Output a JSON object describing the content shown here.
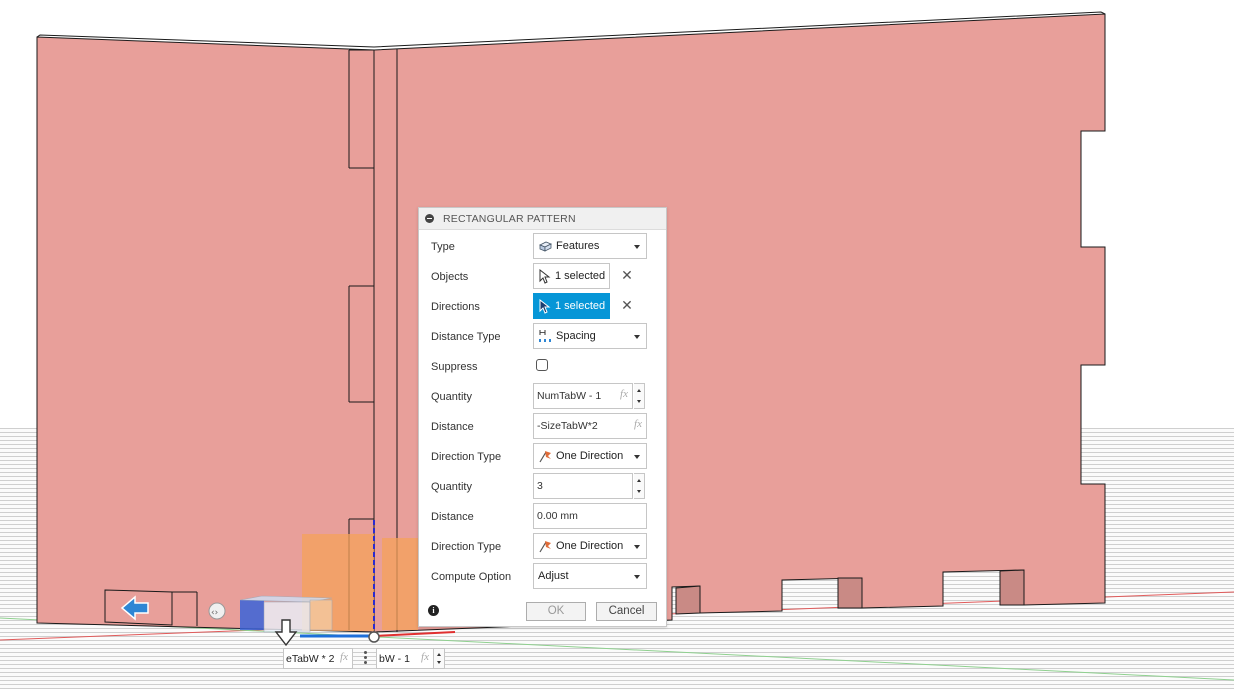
{
  "dialog": {
    "title": "RECTANGULAR PATTERN",
    "type_label": "Type",
    "type_value": "Features",
    "objects_label": "Objects",
    "objects_value": "1 selected",
    "directions_label": "Directions",
    "directions_value": "1 selected",
    "distance_type_label": "Distance Type",
    "distance_type_value": "Spacing",
    "suppress_label": "Suppress",
    "quantity1_label": "Quantity",
    "quantity1_value": "NumTabW - 1",
    "distance1_label": "Distance",
    "distance1_value": "-SizeTabW*2",
    "direction_type1_label": "Direction Type",
    "direction_type1_value": "One Direction",
    "quantity2_label": "Quantity",
    "quantity2_value": "3",
    "distance2_label": "Distance",
    "distance2_value": "0.00 mm",
    "direction_type2_label": "Direction Type",
    "direction_type2_value": "One Direction",
    "compute_option_label": "Compute Option",
    "compute_option_value": "Adjust",
    "ok_label": "OK",
    "cancel_label": "Cancel",
    "fx_label": "fx",
    "clear_symbol": "✕",
    "info_symbol": "i"
  },
  "viewport": {
    "field1_value": "eTabW * 2",
    "field2_value": "bW - 1",
    "fx_label": "fx"
  },
  "colors": {
    "panel_fill": "#e89f9a",
    "active_selection": "#0696d7",
    "preview_orange": "#f5a15a",
    "grid": "#d9d9d9"
  },
  "icons": {
    "features": "features-icon",
    "cursor": "select-cursor-icon",
    "spacing": "spacing-icon",
    "direction": "one-direction-icon"
  }
}
